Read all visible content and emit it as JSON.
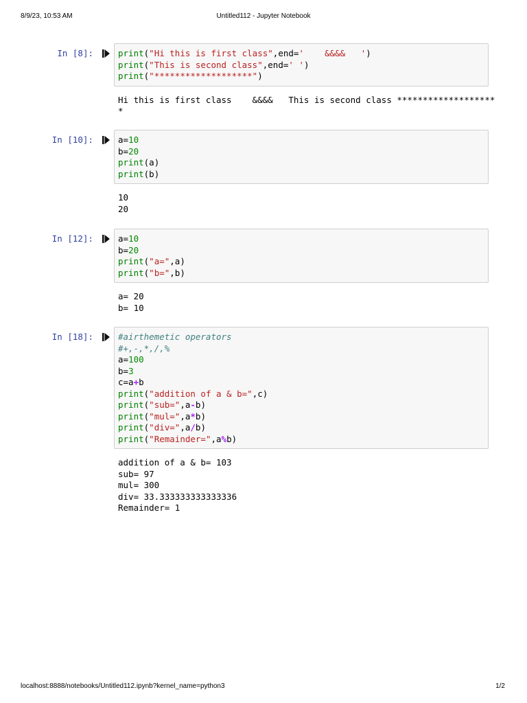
{
  "header": {
    "date": "8/9/23, 10:53 AM",
    "title": "Untitled112 - Jupyter Notebook"
  },
  "footer": {
    "url": "localhost:8888/notebooks/Untitled112.ipynb?kernel_name=python3",
    "page": "1/2"
  },
  "cells": [
    {
      "prompt": "In [8]:",
      "code": [
        [
          [
            "k",
            "print"
          ],
          [
            "t",
            "("
          ],
          [
            "s",
            "\"Hi this is first class\""
          ],
          [
            "t",
            ",end="
          ],
          [
            "s",
            "'    &&&&   '"
          ],
          [
            "t",
            ")"
          ]
        ],
        [
          [
            "k",
            "print"
          ],
          [
            "t",
            "("
          ],
          [
            "s",
            "\"This is second class\""
          ],
          [
            "t",
            ",end="
          ],
          [
            "s",
            "' '"
          ],
          [
            "t",
            ")"
          ]
        ],
        [
          [
            "k",
            "print"
          ],
          [
            "t",
            "("
          ],
          [
            "s",
            "\"*******************\""
          ],
          [
            "t",
            ")"
          ]
        ]
      ],
      "output": [
        "Hi this is first class    &&&&   This is second class *******************",
        "*"
      ]
    },
    {
      "prompt": "In [10]:",
      "code": [
        [
          [
            "t",
            "a="
          ],
          [
            "n",
            "10"
          ]
        ],
        [
          [
            "t",
            "b="
          ],
          [
            "n",
            "20"
          ]
        ],
        [
          [
            "k",
            "print"
          ],
          [
            "t",
            "(a)"
          ]
        ],
        [
          [
            "k",
            "print"
          ],
          [
            "t",
            "(b)"
          ]
        ]
      ],
      "output": [
        "10",
        "20"
      ]
    },
    {
      "prompt": "In [12]:",
      "code": [
        [
          [
            "t",
            "a="
          ],
          [
            "n",
            "10"
          ]
        ],
        [
          [
            "t",
            "b="
          ],
          [
            "n",
            "20"
          ]
        ],
        [
          [
            "k",
            "print"
          ],
          [
            "t",
            "("
          ],
          [
            "s",
            "\"a=\""
          ],
          [
            "t",
            ",a)"
          ]
        ],
        [
          [
            "k",
            "print"
          ],
          [
            "t",
            "("
          ],
          [
            "s",
            "\"b=\""
          ],
          [
            "t",
            ",b)"
          ]
        ]
      ],
      "output": [
        "a= 20",
        "b= 10"
      ]
    },
    {
      "prompt": "In [18]:",
      "code": [
        [
          [
            "c",
            "#airthemetic operators"
          ]
        ],
        [
          [
            "c",
            "#+,-,*,/,%"
          ]
        ],
        [
          [
            "t",
            "a="
          ],
          [
            "n",
            "100"
          ]
        ],
        [
          [
            "t",
            "b="
          ],
          [
            "n",
            "3"
          ]
        ],
        [
          [
            "t",
            "c=a"
          ],
          [
            "o",
            "+"
          ],
          [
            "t",
            "b"
          ]
        ],
        [
          [
            "k",
            "print"
          ],
          [
            "t",
            "("
          ],
          [
            "s",
            "\"addition of a & b=\""
          ],
          [
            "t",
            ",c)"
          ]
        ],
        [
          [
            "k",
            "print"
          ],
          [
            "t",
            "("
          ],
          [
            "s",
            "\"sub=\""
          ],
          [
            "t",
            ",a"
          ],
          [
            "o",
            "-"
          ],
          [
            "t",
            "b)"
          ]
        ],
        [
          [
            "k",
            "print"
          ],
          [
            "t",
            "("
          ],
          [
            "s",
            "\"mul=\""
          ],
          [
            "t",
            ",a"
          ],
          [
            "o",
            "*"
          ],
          [
            "t",
            "b)"
          ]
        ],
        [
          [
            "k",
            "print"
          ],
          [
            "t",
            "("
          ],
          [
            "s",
            "\"div=\""
          ],
          [
            "t",
            ",a"
          ],
          [
            "o",
            "/"
          ],
          [
            "t",
            "b)"
          ]
        ],
        [
          [
            "k",
            "print"
          ],
          [
            "t",
            "("
          ],
          [
            "s",
            "\"Remainder=\""
          ],
          [
            "t",
            ",a"
          ],
          [
            "o",
            "%"
          ],
          [
            "t",
            "b)"
          ]
        ]
      ],
      "output": [
        "addition of a & b= 103",
        "sub= 97",
        "mul= 300",
        "div= 33.333333333333336",
        "Remainder= 1"
      ]
    }
  ]
}
